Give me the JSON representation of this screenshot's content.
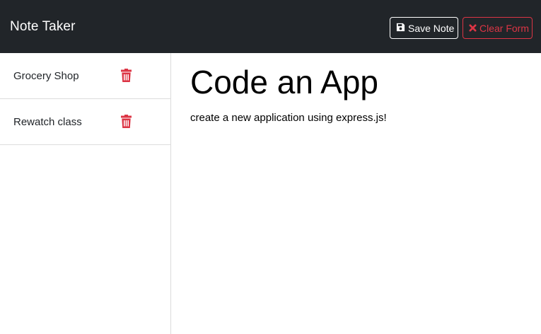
{
  "navbar": {
    "brand": "Note Taker",
    "save_label": "Save Note",
    "clear_label": "Clear Form"
  },
  "notes": [
    {
      "title": "Grocery Shop"
    },
    {
      "title": "Rewatch class"
    }
  ],
  "active_note": {
    "title": "Code an App",
    "text": "create a new application using express.js!"
  },
  "icons": {
    "save": "floppy-disk-icon",
    "clear": "x-icon",
    "delete": "trash-icon"
  },
  "colors": {
    "navbar_bg": "#212529",
    "danger": "#dc3545",
    "text": "#212529"
  }
}
